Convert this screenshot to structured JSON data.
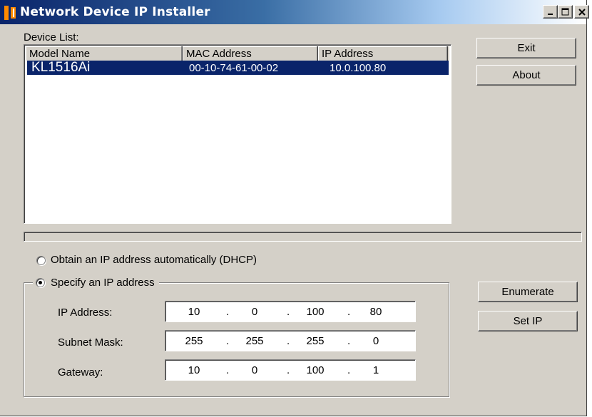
{
  "window": {
    "title": "Network Device IP Installer"
  },
  "titlebar": {
    "minimize_glyph": "_",
    "maximize_glyph": "□",
    "close_glyph": "✕"
  },
  "device_list": {
    "label": "Device List:",
    "columns": [
      "Model Name",
      "MAC Address",
      "IP Address"
    ],
    "rows": [
      {
        "model": "KL1516Ai",
        "mac": "00-10-74-61-00-02",
        "ip": "10.0.100.80",
        "selected": true
      }
    ]
  },
  "buttons": {
    "exit": "Exit",
    "about": "About",
    "enumerate": "Enumerate",
    "set_ip": "Set IP"
  },
  "progress": {
    "value": 0
  },
  "options": {
    "dhcp_label": "Obtain an IP address automatically (DHCP)",
    "dhcp_selected": false,
    "static_label": "Specify an IP address",
    "static_selected": true
  },
  "ip_config": {
    "ip_label": "IP Address:",
    "ip": [
      "10",
      "0",
      "100",
      "80"
    ],
    "subnet_label": "Subnet Mask:",
    "subnet": [
      "255",
      "255",
      "255",
      "0"
    ],
    "gateway_label": "Gateway:",
    "gateway": [
      "10",
      "0",
      "100",
      "1"
    ],
    "separator": "."
  },
  "colors": {
    "titlebar_start": "#0a246a",
    "selection": "#0a246a",
    "face": "#d4d0c8",
    "app_icon": "#ff8a00"
  },
  "icons": {
    "app": "network-installer-app-icon",
    "minimize": "minimize-icon",
    "maximize": "maximize-icon",
    "close": "close-icon"
  }
}
